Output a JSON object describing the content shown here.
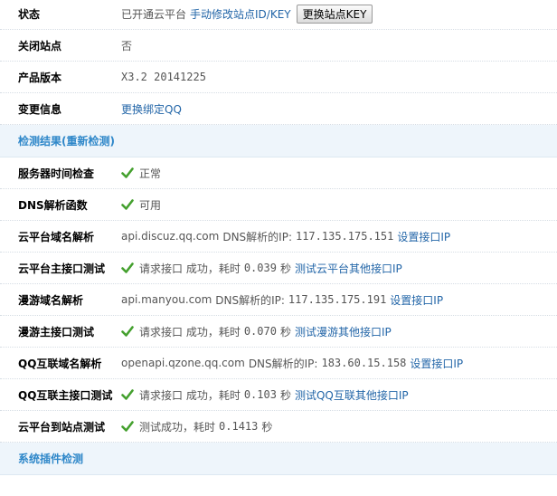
{
  "colors": {
    "link": "#2366a8",
    "section_text": "#2e87c9",
    "check": "#44a02e",
    "section_bg": "#eef5fb"
  },
  "rows": [
    {
      "label": "状态",
      "status_text": "已开通云平台",
      "link": "手动修改站点ID/KEY",
      "button": "更换站点KEY"
    },
    {
      "label": "关闭站点",
      "value": "否"
    },
    {
      "label": "产品版本",
      "value": "X3.2 20141225"
    },
    {
      "label": "变更信息",
      "link": "更换绑定QQ"
    }
  ],
  "section_detect": {
    "title": "检测结果",
    "retest_link": "(重新检测)"
  },
  "checks": {
    "server_time": {
      "label": "服务器时间检查",
      "icon": "check-icon",
      "text": "正常"
    },
    "dns_func": {
      "label": "DNS解析函数",
      "icon": "check-icon",
      "text": "可用"
    },
    "cloud_dns": {
      "label": "云平台域名解析",
      "domain": "api.discuz.qq.com",
      "dns_label": "DNS解析的IP:",
      "ip": "117.135.175.151",
      "link": "设置接口IP"
    },
    "cloud_api": {
      "label": "云平台主接口测试",
      "icon": "check-icon",
      "prefix": "请求接口 成功，耗时",
      "time": "0.039",
      "unit": "秒",
      "link": "测试云平台其他接口IP"
    },
    "manyou_dns": {
      "label": "漫游域名解析",
      "domain": "api.manyou.com",
      "dns_label": "DNS解析的IP:",
      "ip": "117.135.175.191",
      "link": "设置接口IP"
    },
    "manyou_api": {
      "label": "漫游主接口测试",
      "icon": "check-icon",
      "prefix": "请求接口 成功，耗时",
      "time": "0.070",
      "unit": "秒",
      "link": "测试漫游其他接口IP"
    },
    "qq_dns": {
      "label": "QQ互联域名解析",
      "domain": "openapi.qzone.qq.com",
      "dns_label": "DNS解析的IP:",
      "ip": "183.60.15.158",
      "link": "设置接口IP"
    },
    "qq_api": {
      "label": "QQ互联主接口测试",
      "icon": "check-icon",
      "prefix": "请求接口 成功，耗时",
      "time": "0.103",
      "unit": "秒",
      "link": "测试QQ互联其他接口IP"
    },
    "cloud_site": {
      "label": "云平台到站点测试",
      "icon": "check-icon",
      "prefix": "测试成功，耗时",
      "time": "0.1413",
      "unit": "秒"
    }
  },
  "section_plugins": {
    "title": "系统插件检测"
  }
}
